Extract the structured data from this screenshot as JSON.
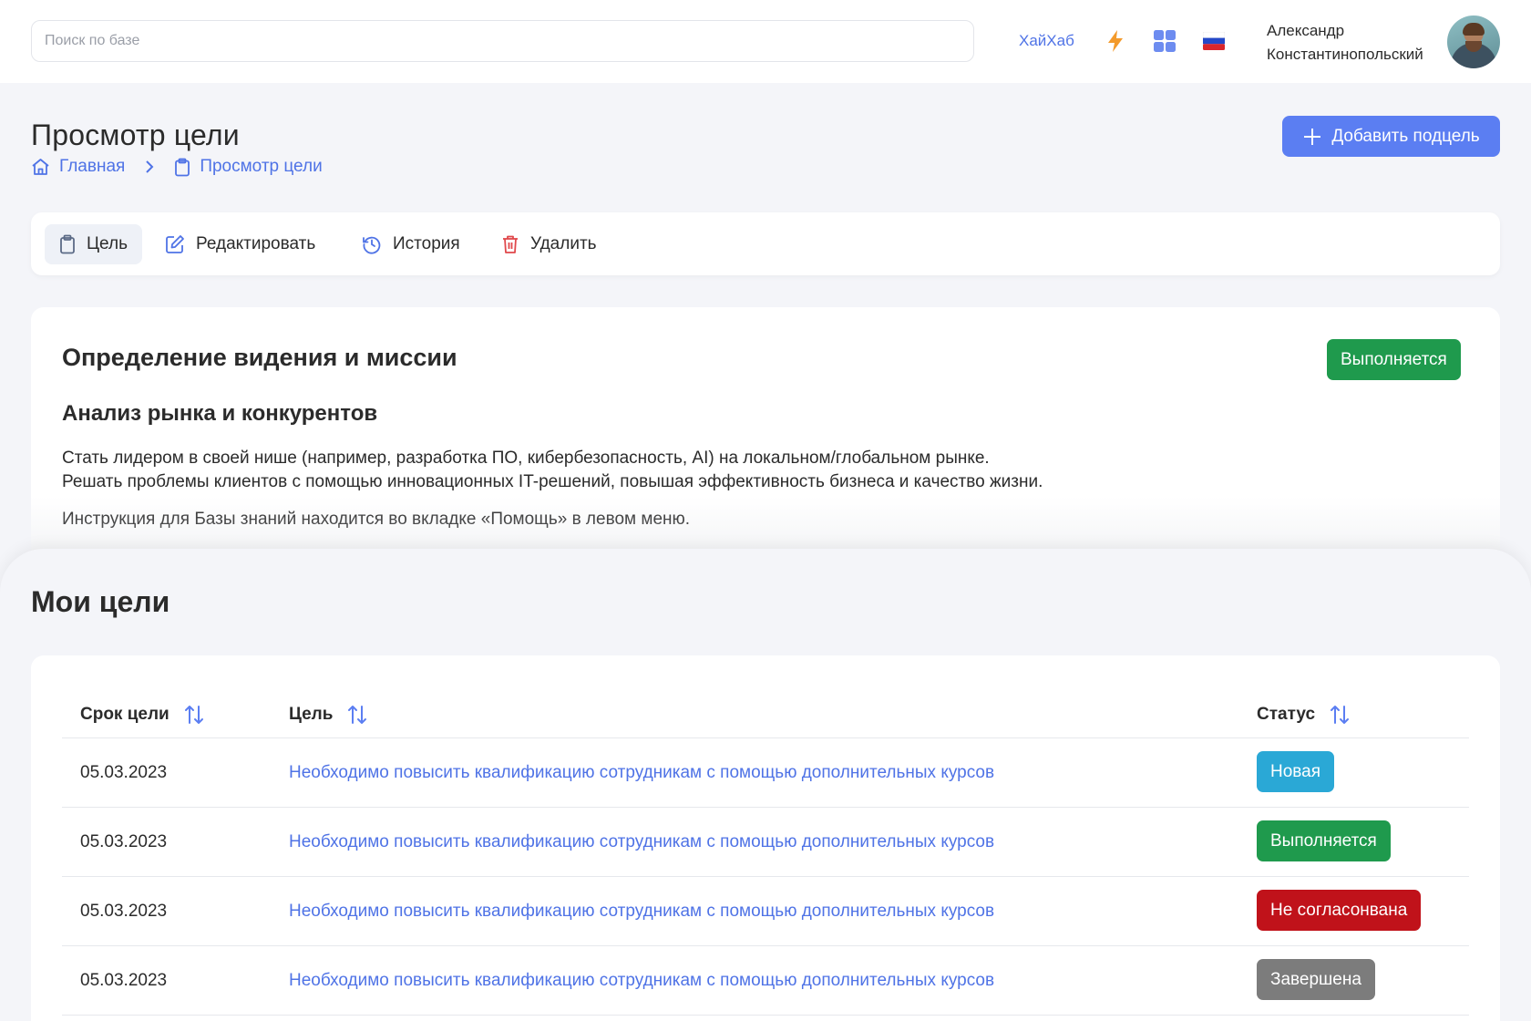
{
  "topbar": {
    "search_placeholder": "Поиск по базе",
    "hub_link": "ХайХаб",
    "icons": [
      "lightning-icon",
      "apps-grid-icon",
      "russian-flag-icon"
    ],
    "user_name_first": "Александр",
    "user_name_last": "Константинопольский"
  },
  "page": {
    "title": "Просмотр цели",
    "breadcrumb": {
      "home": "Главная",
      "current": "Просмотр цели"
    },
    "add_button": "Добавить подцель"
  },
  "tabs": [
    {
      "label": "Цель",
      "icon": "clipboard-icon",
      "active": true
    },
    {
      "label": "Редактировать",
      "icon": "edit-icon",
      "active": false
    },
    {
      "label": "История",
      "icon": "history-icon",
      "active": false
    },
    {
      "label": "Удалить",
      "icon": "trash-icon",
      "active": false
    }
  ],
  "goal": {
    "title": "Определение видения и миссии",
    "status": "Выполняется",
    "subtitle": "Анализ рынка и конкурентов",
    "text_line1": "Стать лидером в своей нише (например, разработка ПО, кибербезопасность, AI) на локальном/глобальном рынке.",
    "text_line2": "Решать проблемы клиентов с помощью инновационных IT-решений, повышая эффективность бизнеса и качество жизни.",
    "note": "Инструкция для Базы знаний находится во вкладке «Помощь» в левом меню."
  },
  "my_goals": {
    "title": "Мои цели",
    "columns": {
      "deadline": "Срок цели",
      "goal": "Цель",
      "status": "Статус"
    },
    "rows": [
      {
        "date": "05.03.2023",
        "goal": "Необходимо повысить квалификацию сотрудникам с помощью дополнительных курсов",
        "status": "Новая"
      },
      {
        "date": "05.03.2023",
        "goal": "Необходимо повысить квалификацию сотрудникам с помощью дополнительных курсов",
        "status": "Выполняется"
      },
      {
        "date": "05.03.2023",
        "goal": "Необходимо повысить квалификацию сотрудникам с помощью дополнительных курсов",
        "status": "Не согласонвана"
      },
      {
        "date": "05.03.2023",
        "goal": "Необходимо повысить квалификацию сотрудникам с помощью дополнительных курсов",
        "status": "Завершена"
      }
    ]
  },
  "colors": {
    "accent": "#5b7ef2",
    "link": "#4f73e6",
    "status_new": "#2aa8d6",
    "status_in_progress": "#1f9a4d",
    "status_rejected": "#c0121a",
    "status_done": "#7c7c7c",
    "danger_icon": "#e0484b"
  }
}
